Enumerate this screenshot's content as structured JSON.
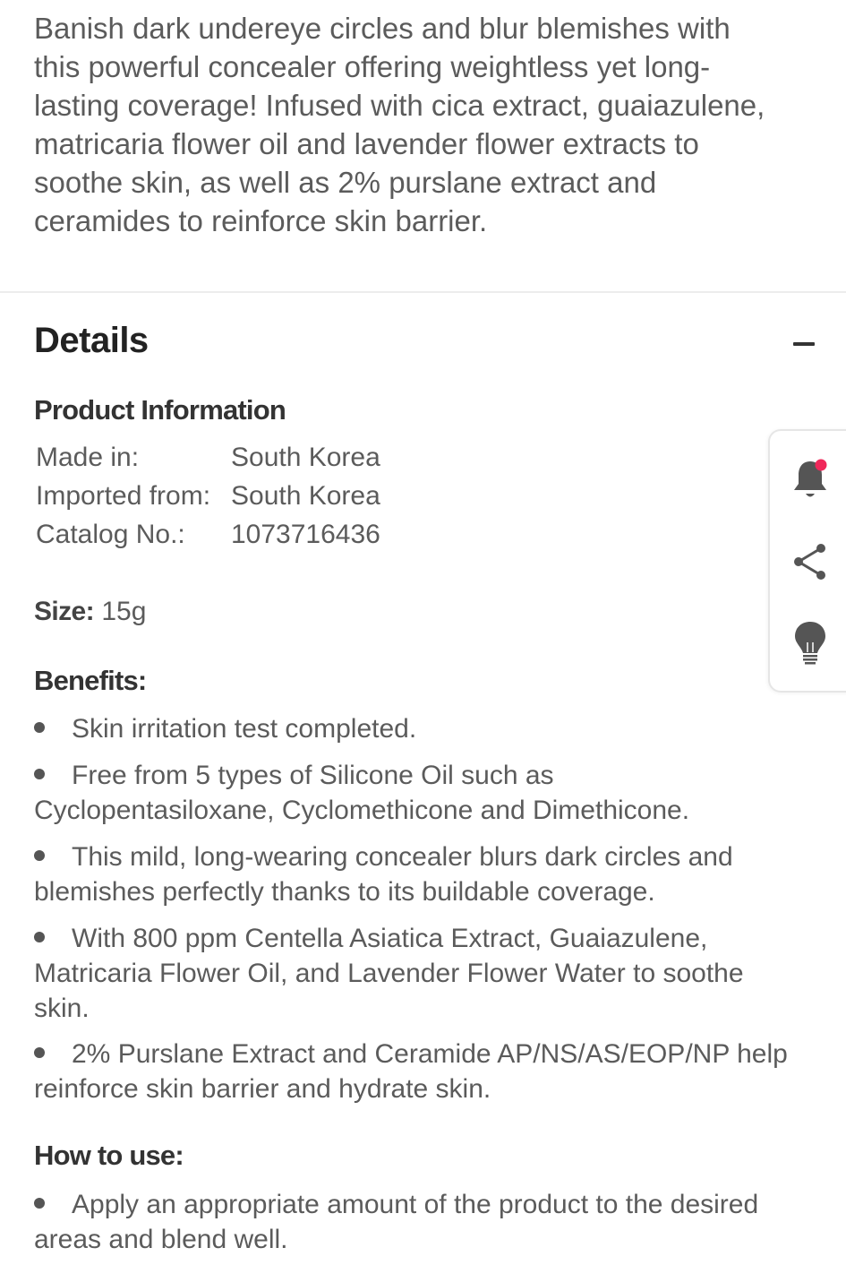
{
  "intro": {
    "lines": [
      "Banish dark undereye circles and blur blemishes with",
      "this powerful concealer offering weightless yet long-",
      "lasting coverage! Infused with cica extract, guaiazulene,",
      "matricaria flower oil and lavender flower extracts to",
      "soothe skin, as well as 2% purslane extract and",
      "ceramides to reinforce skin barrier."
    ]
  },
  "details": {
    "title": "Details",
    "collapse_icon": "minus-icon"
  },
  "product_info": {
    "heading": "Product Information",
    "rows": [
      {
        "label": "Made in:",
        "value": "South Korea"
      },
      {
        "label": "Imported from:",
        "value": "South Korea"
      },
      {
        "label": "Catalog No.:",
        "value": "1073716436"
      }
    ]
  },
  "size": {
    "label": "Size:",
    "value": " 15g"
  },
  "benefits": {
    "heading": "Benefits:",
    "items": [
      [
        "Skin irritation test completed."
      ],
      [
        "Free from 5 types of Silicone Oil such as",
        "Cyclopentasiloxane, Cyclomethicone and Dimethicone."
      ],
      [
        "This mild, long-wearing concealer blurs dark circles and",
        "blemishes perfectly thanks to its buildable coverage."
      ],
      [
        "With 800 ppm Centella Asiatica Extract, Guaiazulene,",
        "Matricaria Flower Oil, and Lavender Flower Water to soothe",
        "skin."
      ],
      [
        "2% Purslane Extract and Ceramide AP/NS/AS/EOP/NP help",
        "reinforce skin barrier and hydrate skin."
      ]
    ]
  },
  "how_to_use": {
    "heading": "How to use:",
    "items": [
      [
        "Apply an appropriate amount of the product to the desired",
        "areas and blend well."
      ]
    ]
  },
  "side_panel": {
    "icons": [
      "bell-icon",
      "share-icon",
      "lightbulb-icon"
    ],
    "notification_dot_color": "#f0285a"
  },
  "colors": {
    "text": "#5b5b5b",
    "heading": "#222222",
    "divider": "#ececec",
    "icon": "#555555"
  }
}
